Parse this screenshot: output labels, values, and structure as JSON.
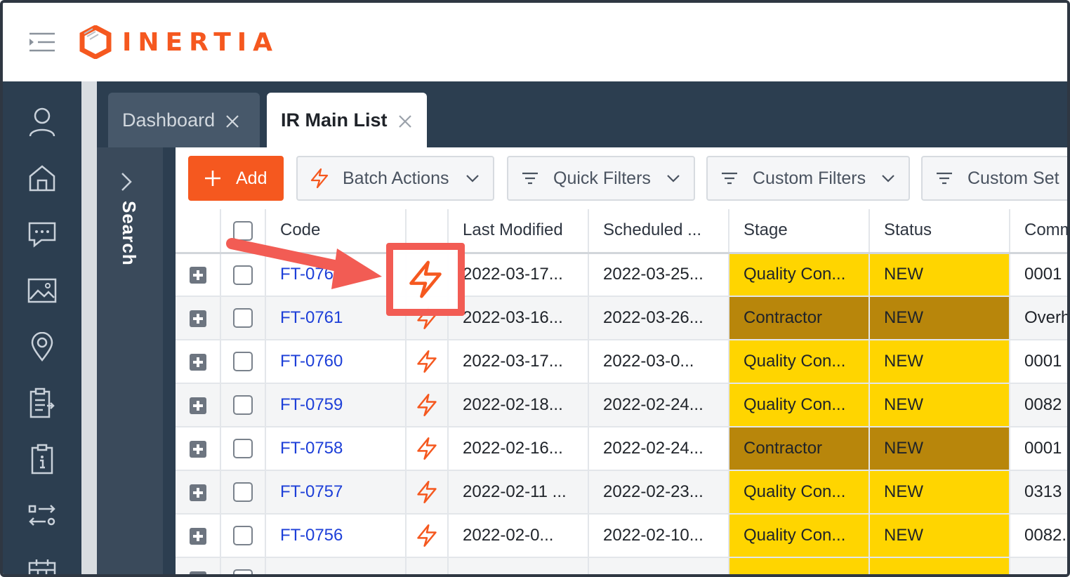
{
  "header": {
    "logo_text": "INERTIA",
    "brand_color": "#f5581f"
  },
  "rail": {
    "items": [
      "user-icon",
      "home-icon",
      "chat-icon",
      "image-icon",
      "location-pin-icon",
      "clipboard-list-icon",
      "clipboard-info-icon",
      "transfer-icon",
      "calendar-icon"
    ]
  },
  "tabs": [
    {
      "label": "Dashboard",
      "active": false
    },
    {
      "label": "IR Main List",
      "active": true
    }
  ],
  "search_panel": {
    "label": "Search"
  },
  "toolbar": {
    "add_label": "Add",
    "batch_label": "Batch Actions",
    "quick_label": "Quick Filters",
    "custom_label": "Custom Filters",
    "set_label": "Custom Set"
  },
  "columns": [
    "Code",
    "Last Modified",
    "Scheduled ...",
    "Stage",
    "Status",
    "Comm"
  ],
  "rows": [
    {
      "code": "FT-0762",
      "last_modified": "2022-03-17...",
      "scheduled": "2022-03-25...",
      "stage": "Quality Con...",
      "stage_kind": "q",
      "status": "NEW",
      "comm": "0001"
    },
    {
      "code": "FT-0761",
      "last_modified": "2022-03-16...",
      "scheduled": "2022-03-26...",
      "stage": "Contractor",
      "stage_kind": "c",
      "status": "NEW",
      "comm": "Overh"
    },
    {
      "code": "FT-0760",
      "last_modified": "2022-03-17...",
      "scheduled": "2022-03-0...",
      "stage": "Quality Con...",
      "stage_kind": "q",
      "status": "NEW",
      "comm": "0001"
    },
    {
      "code": "FT-0759",
      "last_modified": "2022-02-18...",
      "scheduled": "2022-02-24...",
      "stage": "Quality Con...",
      "stage_kind": "q",
      "status": "NEW",
      "comm": "0082"
    },
    {
      "code": "FT-0758",
      "last_modified": "2022-02-16...",
      "scheduled": "2022-02-24...",
      "stage": "Contractor",
      "stage_kind": "c",
      "status": "NEW",
      "comm": "0001"
    },
    {
      "code": "FT-0757",
      "last_modified": "2022-02-11 ...",
      "scheduled": "2022-02-23...",
      "stage": "Quality Con...",
      "stage_kind": "q",
      "status": "NEW",
      "comm": "0313"
    },
    {
      "code": "FT-0756",
      "last_modified": "2022-02-0...",
      "scheduled": "2022-02-10...",
      "stage": "Quality Con...",
      "stage_kind": "q",
      "status": "NEW",
      "comm": "0082."
    },
    {
      "code": "",
      "last_modified": "",
      "scheduled": "",
      "stage": "",
      "stage_kind": "q",
      "status": "",
      "comm": ""
    }
  ],
  "colors": {
    "stage_quality": "#ffd500",
    "stage_contractor": "#b8860b",
    "annotation": "#f25c54",
    "link": "#1d3fd8"
  }
}
